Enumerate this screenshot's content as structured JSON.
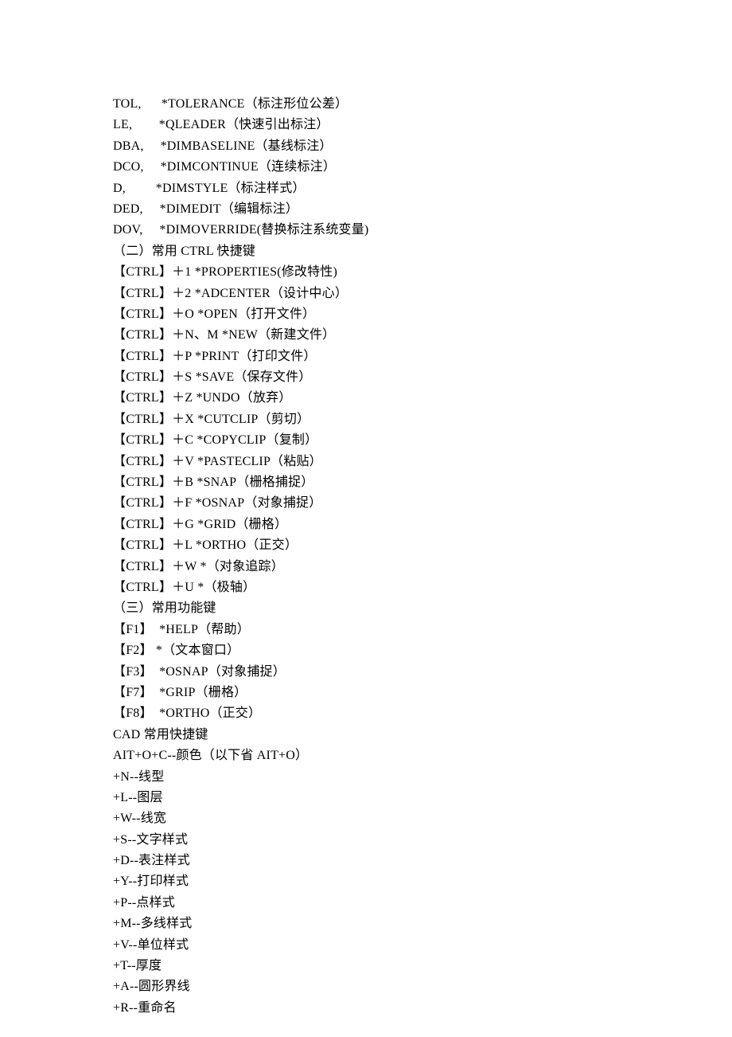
{
  "lines": [
    "TOL,      *TOLERANCE（标注形位公差）",
    "LE,        *QLEADER（快速引出标注）",
    "DBA,     *DIMBASELINE（基线标注）",
    "DCO,     *DIMCONTINUE（连续标注）",
    "D,         *DIMSTYLE（标注样式）",
    "DED,     *DIMEDIT（编辑标注）",
    "DOV,     *DIMOVERRIDE(替换标注系统变量)",
    "（二）常用 CTRL 快捷键",
    "【CTRL】＋1 *PROPERTIES(修改特性)",
    "【CTRL】＋2 *ADCENTER（设计中心）",
    "【CTRL】＋O *OPEN（打开文件）",
    "【CTRL】＋N、M *NEW（新建文件）",
    "【CTRL】＋P *PRINT（打印文件）",
    "【CTRL】＋S *SAVE（保存文件）",
    "【CTRL】＋Z *UNDO（放弃）",
    "【CTRL】＋X *CUTCLIP（剪切）",
    "【CTRL】＋C *COPYCLIP（复制）",
    "【CTRL】＋V *PASTECLIP（粘贴）",
    "【CTRL】＋B *SNAP（栅格捕捉）",
    "【CTRL】＋F *OSNAP（对象捕捉）",
    "【CTRL】＋G *GRID（栅格）",
    "【CTRL】＋L *ORTHO（正交）",
    "【CTRL】＋W *（对象追踪）",
    "【CTRL】＋U *（极轴）",
    "（三）常用功能键",
    "【F1】  *HELP（帮助）",
    "【F2】 *（文本窗口）",
    "【F3】  *OSNAP（对象捕捉）",
    "【F7】  *GRIP（栅格）",
    "【F8】  *ORTHO（正交）",
    "CAD 常用快捷键",
    "AIT+O+C--颜色（以下省 AIT+O）",
    "+N--线型",
    "+L--图层",
    "+W--线宽",
    "+S--文字样式",
    "+D--表注样式",
    "+Y--打印样式",
    "+P--点样式",
    "+M--多线样式",
    "+V--单位样式",
    "+T--厚度",
    "+A--圆形界线",
    "+R--重命名"
  ]
}
